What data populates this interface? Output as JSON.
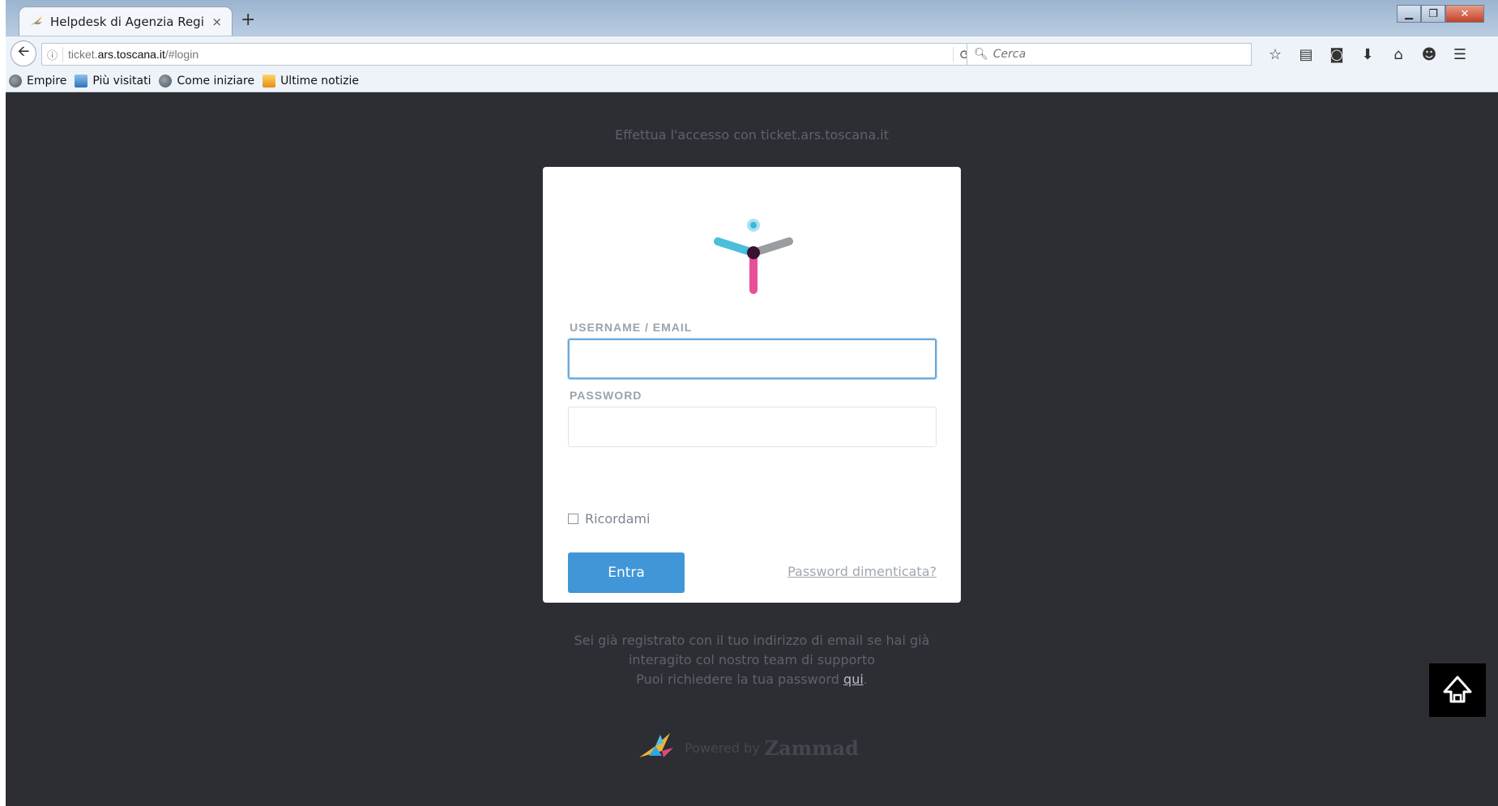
{
  "browser": {
    "tab_title": "Helpdesk di Agenzia Regi...",
    "tab_close": "×",
    "new_tab": "+",
    "url_host_prefix": "ticket.",
    "url_host_main": "ars.toscana.it",
    "url_path": "/#login",
    "search_placeholder": "Cerca",
    "window_controls": [
      "minimize",
      "restore",
      "close"
    ],
    "toolbar_icons": [
      "star-icon",
      "reading-list-icon",
      "pocket-icon",
      "download-icon",
      "home-icon",
      "chat-icon",
      "menu-icon"
    ],
    "bookmarks": [
      {
        "label": "Empire",
        "icon": "globe-icon"
      },
      {
        "label": "Più visitati",
        "icon": "bookmark-folder-icon"
      },
      {
        "label": "Come iniziare",
        "icon": "globe-icon"
      },
      {
        "label": "Ultime notizie",
        "icon": "rss-icon"
      }
    ]
  },
  "page": {
    "intro": "Effettua l'accesso con ticket.ars.toscana.it",
    "form": {
      "username_label": "USERNAME / EMAIL",
      "username_value": "",
      "password_label": "PASSWORD",
      "password_value": "",
      "remember_label": "Ricordami",
      "remember_checked": false,
      "submit_label": "Entra",
      "forgot_label": "Password dimenticata?"
    },
    "help": {
      "line1": "Sei già registrato con il tuo indirizzo di email se hai già",
      "line2": "interagito col nostro team di supporto",
      "line3_prefix": "Puoi richiedere la tua password ",
      "line3_link": "qui",
      "line3_suffix": "."
    },
    "powered_by": "Powered by",
    "brand": "Zammad"
  },
  "colors": {
    "page_bg": "#2d2e33",
    "primary_button": "#4196d7",
    "logo_cyan": "#39b6d8",
    "logo_pink": "#e63c8e",
    "logo_gray": "#8f9296"
  }
}
